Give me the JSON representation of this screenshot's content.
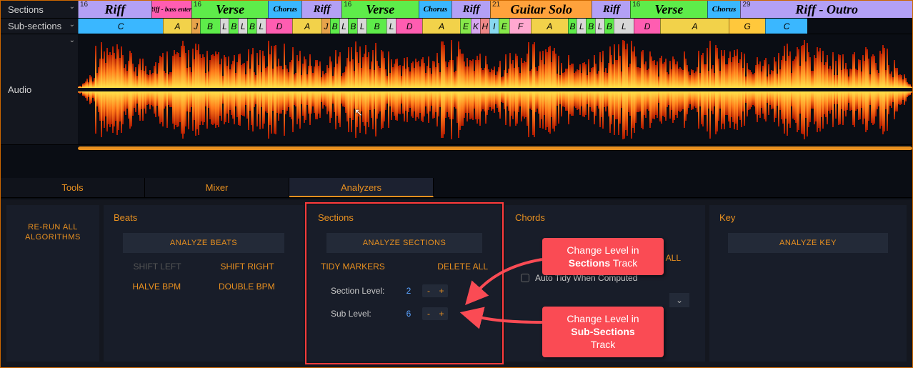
{
  "tracks": {
    "sections_label": "Sections",
    "subsections_label": "Sub-sections",
    "audio_label": "Audio"
  },
  "sections": [
    {
      "num": "16",
      "label": "Riff",
      "color": "#b3a0f5",
      "w": 8.8,
      "fs": 18
    },
    {
      "num": "",
      "label": "Riff - bass enters",
      "color": "#ff5db1",
      "w": 4.8,
      "fs": 9
    },
    {
      "num": "16",
      "label": "Verse",
      "color": "#5eec4a",
      "w": 9.2,
      "fs": 18
    },
    {
      "num": "",
      "label": "Chorus",
      "color": "#3ab7ff",
      "w": 4.0,
      "fs": 11
    },
    {
      "num": "",
      "label": "Riff",
      "color": "#b3a0f5",
      "w": 4.8,
      "fs": 15
    },
    {
      "num": "16",
      "label": "Verse",
      "color": "#5eec4a",
      "w": 9.2,
      "fs": 18
    },
    {
      "num": "",
      "label": "Chorus",
      "color": "#3ab7ff",
      "w": 4.0,
      "fs": 11
    },
    {
      "num": "",
      "label": "Riff",
      "color": "#b3a0f5",
      "w": 4.6,
      "fs": 15
    },
    {
      "num": "21",
      "label": "Guitar Solo",
      "color": "#ffa23c",
      "w": 12.2,
      "fs": 18
    },
    {
      "num": "",
      "label": "Riff",
      "color": "#b3a0f5",
      "w": 4.6,
      "fs": 15
    },
    {
      "num": "16",
      "label": "Verse",
      "color": "#5eec4a",
      "w": 9.2,
      "fs": 18
    },
    {
      "num": "",
      "label": "Chorus",
      "color": "#3ab7ff",
      "w": 4.0,
      "fs": 11
    },
    {
      "num": "29",
      "label": "Riff - Outro",
      "color": "#b3a0f5",
      "w": 20.6,
      "fs": 18
    }
  ],
  "subsections": [
    {
      "label": "C",
      "color": "#3ab7ff",
      "w": 10.2
    },
    {
      "label": "A",
      "color": "#f2d24a",
      "w": 3.4
    },
    {
      "label": "J",
      "color": "#e6a34a",
      "w": 1.0
    },
    {
      "label": "B",
      "color": "#5eec4a",
      "w": 2.4
    },
    {
      "label": "L",
      "color": "#d8d8d8",
      "w": 1.1
    },
    {
      "label": "B",
      "color": "#5eec4a",
      "w": 1.1
    },
    {
      "label": "L",
      "color": "#d8d8d8",
      "w": 1.1
    },
    {
      "label": "B",
      "color": "#5eec4a",
      "w": 1.1
    },
    {
      "label": "L",
      "color": "#d8d8d8",
      "w": 1.1
    },
    {
      "label": "D",
      "color": "#ff5db1",
      "w": 3.2
    },
    {
      "label": "A",
      "color": "#f2d24a",
      "w": 3.5
    },
    {
      "label": "J",
      "color": "#e6a34a",
      "w": 1.0
    },
    {
      "label": "B",
      "color": "#5eec4a",
      "w": 1.1
    },
    {
      "label": "L",
      "color": "#d8d8d8",
      "w": 1.1
    },
    {
      "label": "B",
      "color": "#5eec4a",
      "w": 1.1
    },
    {
      "label": "L",
      "color": "#d8d8d8",
      "w": 1.1
    },
    {
      "label": "B",
      "color": "#5eec4a",
      "w": 2.4
    },
    {
      "label": "L",
      "color": "#d8d8d8",
      "w": 1.1
    },
    {
      "label": "D",
      "color": "#ff5db1",
      "w": 3.2
    },
    {
      "label": "A",
      "color": "#f2d24a",
      "w": 4.5
    },
    {
      "label": "E",
      "color": "#86e84a",
      "w": 1.3
    },
    {
      "label": "K",
      "color": "#d8a8f0",
      "w": 1.1
    },
    {
      "label": "H",
      "color": "#f08888",
      "w": 1.1
    },
    {
      "label": "I",
      "color": "#88d8f0",
      "w": 1.1
    },
    {
      "label": "E",
      "color": "#86e84a",
      "w": 1.3
    },
    {
      "label": "F",
      "color": "#ffa8d0",
      "w": 2.6
    },
    {
      "label": "A",
      "color": "#f2d24a",
      "w": 4.4
    },
    {
      "label": "B",
      "color": "#5eec4a",
      "w": 1.1
    },
    {
      "label": "L",
      "color": "#d8d8d8",
      "w": 1.1
    },
    {
      "label": "B",
      "color": "#5eec4a",
      "w": 1.1
    },
    {
      "label": "L",
      "color": "#d8d8d8",
      "w": 1.1
    },
    {
      "label": "B",
      "color": "#5eec4a",
      "w": 1.1
    },
    {
      "label": "L",
      "color": "#d8d8d8",
      "w": 2.4
    },
    {
      "label": "D",
      "color": "#ff5db1",
      "w": 3.2
    },
    {
      "label": "A",
      "color": "#f2d24a",
      "w": 8.2
    },
    {
      "label": "G",
      "color": "#ffc83c",
      "w": 4.4
    },
    {
      "label": "C",
      "color": "#3ab7ff",
      "w": 5.0
    }
  ],
  "tabs": {
    "tools": "Tools",
    "mixer": "Mixer",
    "analyzers": "Analyzers"
  },
  "panels": {
    "rerun": "RE-RUN ALL ALGORITHMS",
    "beats": {
      "title": "Beats",
      "analyze": "ANALYZE BEATS",
      "shift_left": "SHIFT LEFT",
      "shift_right": "SHIFT RIGHT",
      "halve": "HALVE BPM",
      "double": "DOUBLE BPM"
    },
    "sections": {
      "title": "Sections",
      "analyze": "ANALYZE SECTIONS",
      "tidy": "TIDY MARKERS",
      "delete": "DELETE ALL",
      "section_level_label": "Section Level:",
      "section_level": "2",
      "sub_level_label": "Sub Level:",
      "sub_level": "6",
      "minus": "-",
      "plus": "+"
    },
    "chords": {
      "title": "Chords",
      "delete": "ALL",
      "auto_tidy": "Auto Tidy When Computed"
    },
    "key": {
      "title": "Key",
      "analyze": "ANALYZE KEY"
    }
  },
  "callouts": {
    "c1_line1": "Change Level in",
    "c1_bold": "Sections",
    "c1_line2": " Track",
    "c2_line1": "Change Level in",
    "c2_bold": "Sub-Sections",
    "c2_line2": "Track"
  }
}
